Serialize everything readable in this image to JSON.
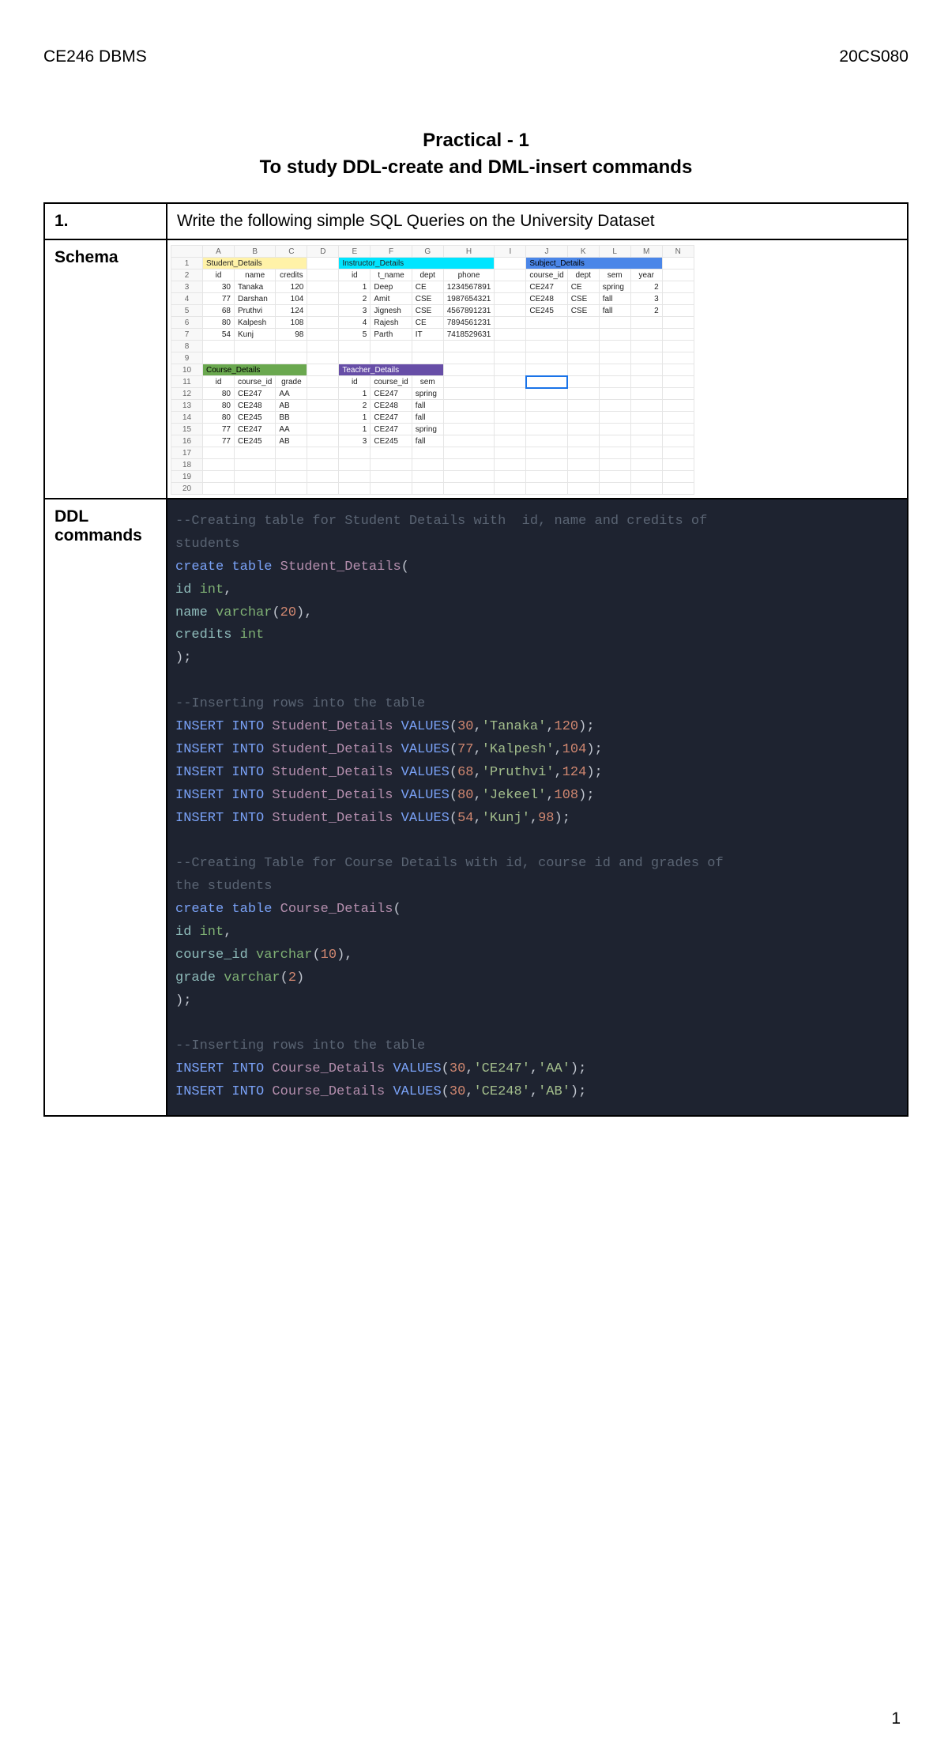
{
  "header": {
    "left": "CE246 DBMS",
    "right": "20CS080"
  },
  "title": "Practical - 1",
  "subtitle": "To study DDL-create and DML-insert commands",
  "rows": {
    "q_num": "1.",
    "q_text": "Write the following simple SQL Queries on the University Dataset",
    "schema_label": "Schema",
    "ddl_label": "DDL commands"
  },
  "sheet": {
    "cols": [
      "A",
      "B",
      "C",
      "D",
      "E",
      "F",
      "G",
      "H",
      "I",
      "J",
      "K",
      "L",
      "M",
      "N"
    ],
    "student_header": "Student_Details",
    "instructor_header": "Instructor_Details",
    "subject_header": "Subject_Details",
    "course_header": "Course_Details",
    "teacher_header": "Teacher_Details",
    "student_cols": [
      "id",
      "name",
      "credits"
    ],
    "instructor_cols": [
      "id",
      "t_name",
      "dept",
      "phone"
    ],
    "subject_cols": [
      "course_id",
      "dept",
      "sem",
      "year"
    ],
    "course_cols": [
      "id",
      "course_id",
      "grade"
    ],
    "teacher_cols": [
      "id",
      "course_id",
      "sem"
    ],
    "students": [
      {
        "id": "30",
        "name": "Tanaka",
        "credits": "120"
      },
      {
        "id": "77",
        "name": "Darshan",
        "credits": "104"
      },
      {
        "id": "68",
        "name": "Pruthvi",
        "credits": "124"
      },
      {
        "id": "80",
        "name": "Kalpesh",
        "credits": "108"
      },
      {
        "id": "54",
        "name": "Kunj",
        "credits": "98"
      }
    ],
    "instructors": [
      {
        "id": "1",
        "name": "Deep",
        "dept": "CE",
        "phone": "1234567891"
      },
      {
        "id": "2",
        "name": "Amit",
        "dept": "CSE",
        "phone": "1987654321"
      },
      {
        "id": "3",
        "name": "Jignesh",
        "dept": "CSE",
        "phone": "4567891231"
      },
      {
        "id": "4",
        "name": "Rajesh",
        "dept": "CE",
        "phone": "7894561231"
      },
      {
        "id": "5",
        "name": "Parth",
        "dept": "IT",
        "phone": "7418529631"
      }
    ],
    "subjects": [
      {
        "cid": "CE247",
        "dept": "CE",
        "sem": "spring",
        "year": "2"
      },
      {
        "cid": "CE248",
        "dept": "CSE",
        "sem": "fall",
        "year": "3"
      },
      {
        "cid": "CE245",
        "dept": "CSE",
        "sem": "fall",
        "year": "2"
      }
    ],
    "courses": [
      {
        "id": "80",
        "cid": "CE247",
        "grade": "AA"
      },
      {
        "id": "80",
        "cid": "CE248",
        "grade": "AB"
      },
      {
        "id": "80",
        "cid": "CE245",
        "grade": "BB"
      },
      {
        "id": "77",
        "cid": "CE247",
        "grade": "AA"
      },
      {
        "id": "77",
        "cid": "CE245",
        "grade": "AB"
      }
    ],
    "teachers": [
      {
        "id": "1",
        "cid": "CE247",
        "sem": "spring"
      },
      {
        "id": "2",
        "cid": "CE248",
        "sem": "fall"
      },
      {
        "id": "1",
        "cid": "CE247",
        "sem": "fall"
      },
      {
        "id": "1",
        "cid": "CE247",
        "sem": "spring"
      },
      {
        "id": "3",
        "cid": "CE245",
        "sem": "fall"
      }
    ]
  },
  "code": {
    "c1": "--Creating table for Student Details with  id, name and credits of",
    "c1b": "students",
    "l1": "create table",
    "l1b": "Student_Details",
    "l2a": "id",
    "l2b": "int",
    "l3a": "name",
    "l3b": "varchar",
    "l3c": "20",
    "l4a": "credits",
    "l4b": "int",
    "c2": "--Inserting rows into the table",
    "ins": "INSERT INTO",
    "val": "VALUES",
    "tbl1": "Student_Details",
    "r1": [
      "30",
      "'Tanaka'",
      "120"
    ],
    "r2": [
      "77",
      "'Kalpesh'",
      "104"
    ],
    "r3": [
      "68",
      "'Pruthvi'",
      "124"
    ],
    "r4": [
      "80",
      "'Jekeel'",
      "108"
    ],
    "r5": [
      "54",
      "'Kunj'",
      "98"
    ],
    "c3": "--Creating Table for Course Details with id, course id and grades of",
    "c3b": "the students",
    "tbl2": "Course_Details",
    "l5a": "id",
    "l5b": "int",
    "l6a": "course_id",
    "l6b": "varchar",
    "l6c": "10",
    "l7a": "grade",
    "l7b": "varchar",
    "l7c": "2",
    "c4": "--Inserting rows into the table",
    "r6": [
      "30",
      "'CE247'",
      "'AA'"
    ],
    "r7": [
      "30",
      "'CE248'",
      "'AB'"
    ]
  },
  "page_num": "1"
}
